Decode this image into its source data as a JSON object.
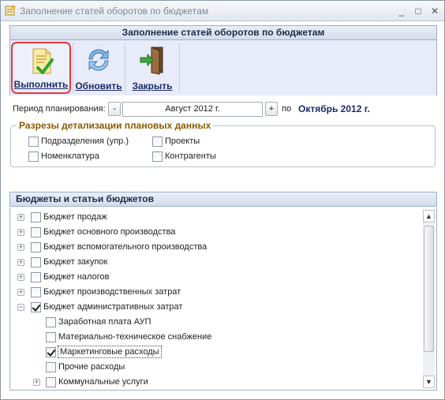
{
  "window": {
    "title": "Заполнение статей оборотов по бюджетам",
    "minimize_glyph": "_",
    "maximize_glyph": "□",
    "close_glyph": "✕"
  },
  "header": {
    "title": "Заполнение статей оборотов по бюджетам"
  },
  "toolbar": {
    "run_label": "Выполнить",
    "refresh_label": "Обновить",
    "close_label": "Закрыть",
    "run_icon": "document-check-icon",
    "refresh_icon": "refresh-arrows-icon",
    "close_icon": "exit-door-icon"
  },
  "period": {
    "label": "Период планирования:",
    "minus": "-",
    "value": "Август 2012 г.",
    "plus": "+",
    "to_label": "по",
    "end_value": "Октябрь 2012 г."
  },
  "details": {
    "title": "Разрезы детализации плановых данных",
    "options": [
      {
        "label": "Подразделения (упр.)",
        "checked": false
      },
      {
        "label": "Проекты",
        "checked": false
      },
      {
        "label": "Номенклатура",
        "checked": false
      },
      {
        "label": "Контрагенты",
        "checked": false
      }
    ]
  },
  "budgets": {
    "title": "Бюджеты и статьи бюджетов",
    "items": [
      {
        "label": "Бюджет продаж",
        "checked": false,
        "expander": "+"
      },
      {
        "label": "Бюджет основного производства",
        "checked": false,
        "expander": "+"
      },
      {
        "label": "Бюджет вспомогательного производства",
        "checked": false,
        "expander": "+"
      },
      {
        "label": "Бюджет закупок",
        "checked": false,
        "expander": "+"
      },
      {
        "label": "Бюджет налогов",
        "checked": false,
        "expander": "+"
      },
      {
        "label": "Бюджет производственных затрат",
        "checked": false,
        "expander": "+"
      },
      {
        "label": "Бюджет административных затрат",
        "checked": true,
        "expander": "−"
      },
      {
        "label": "Заработная плата АУП",
        "checked": false
      },
      {
        "label": "Материально-техническое снабжение",
        "checked": false
      },
      {
        "label": "Маркетинговые расходы",
        "checked": true
      },
      {
        "label": "Прочие расходы",
        "checked": false
      },
      {
        "label": "Коммунальные услуги",
        "checked": false,
        "expander": "+"
      }
    ]
  },
  "colors": {
    "accent_red": "#e23b3b",
    "header_blue": "#1c2a6b",
    "group_title": "#8a5a00",
    "toolbar_bg": "#e8ebfa"
  }
}
